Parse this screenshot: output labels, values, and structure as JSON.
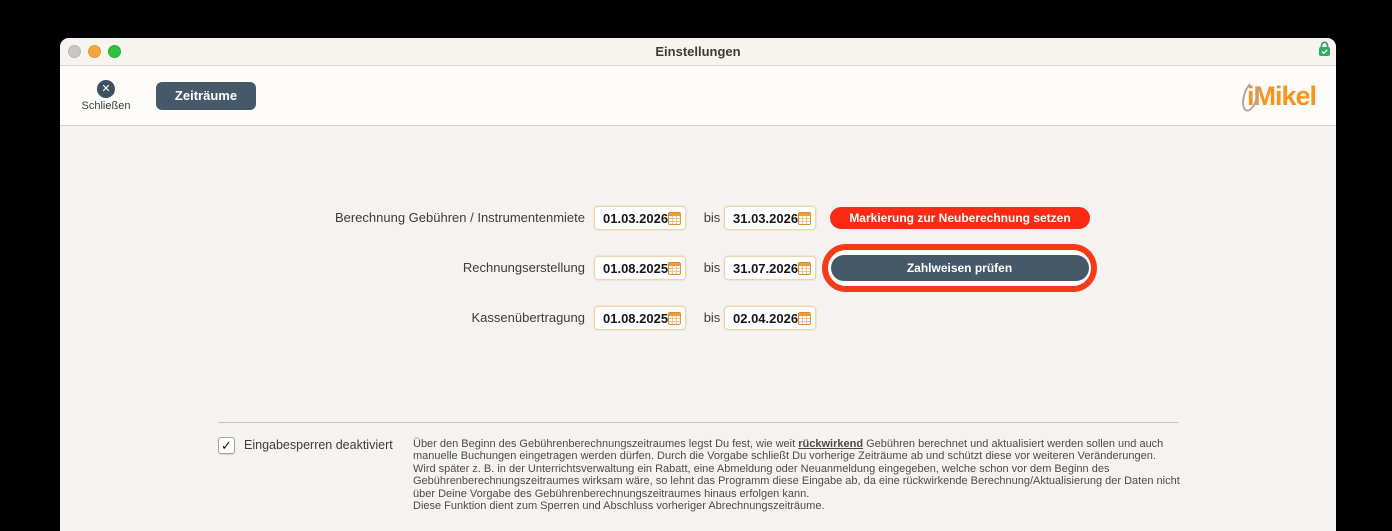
{
  "window": {
    "title": "Einstellungen"
  },
  "titlebar": {
    "traffic_lights": [
      "gray",
      "yellow",
      "green"
    ],
    "lock_icon": "lock-with-checkmark"
  },
  "toolbar": {
    "close_label": "Schließen",
    "close_icon_glyph": "✕",
    "tab_label": "Zeiträume",
    "logo_text": "iMikel"
  },
  "rows": [
    {
      "label": "Berechnung Gebühren / Instrumentenmiete",
      "from": "01.03.2026",
      "bis": "bis",
      "to": "31.03.2026",
      "action": "Markierung zur Neuberechnung setzen"
    },
    {
      "label": "Rechnungserstellung",
      "from": "01.08.2025",
      "bis": "bis",
      "to": "31.07.2026",
      "action": "Zahlweisen prüfen",
      "highlighted": true
    },
    {
      "label": "Kassenübertragung",
      "from": "01.08.2025",
      "bis": "bis",
      "to": "02.04.2026"
    }
  ],
  "footer": {
    "checkbox_checked": true,
    "checkbox_glyph": "✓",
    "checkbox_label": "Eingabesperren deaktiviert",
    "p1_before": "Über den Beginn des Gebührenberechnungszeitraumes legst Du fest, wie weit ",
    "p1_keyword": "rückwirkend",
    "p1_after": " Gebühren berechnet und aktualisiert werden sollen und auch manuelle Buchungen eingetragen werden dürfen. Durch die Vorgabe schließt Du vorherige Zeiträume ab und schützt diese vor weiteren Veränderungen.",
    "p2": "Wird später z. B. in der Unterrichtsverwaltung ein Rabatt, eine Abmeldung oder Neuanmeldung eingegeben, welche schon vor dem Beginn des Gebührenberechnungszeitraumes wirksam wäre, so lehnt das Programm diese Eingabe ab, da eine rückwirkende Berechnung/Aktualisierung der Daten nicht über Deine Vorgabe des Gebührenberechnungszeitraumes hinaus erfolgen kann.",
    "p3": "Diese Funktion dient zum Sperren und Abschluss vorheriger Abrechnungszeiträume."
  },
  "colors": {
    "accent_red": "#fb2a14",
    "highlight_ring_red": "#f53b17",
    "slate": "#45596a",
    "logo_orange": "#f7941e",
    "date_border_tan": "#e9d5b2",
    "content_bg": "#f4f3f2"
  }
}
